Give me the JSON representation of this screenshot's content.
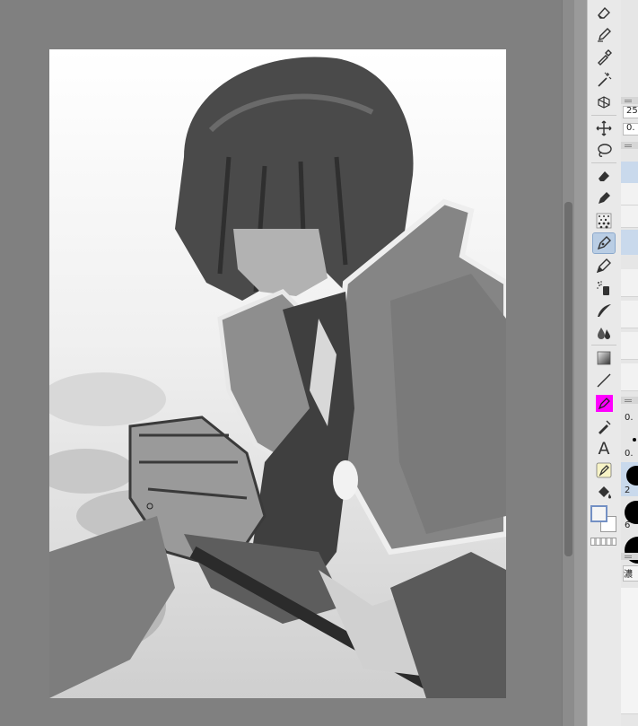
{
  "canvas": {
    "artwork": "grayscale painting"
  },
  "toolbar": {
    "tools": [
      {
        "name": "eraser-icon"
      },
      {
        "name": "pen-check-icon"
      },
      {
        "name": "eyedropper-icon"
      },
      {
        "name": "magic-wand-icon"
      },
      {
        "name": "object-select-icon"
      },
      {
        "name": "move-icon"
      },
      {
        "name": "lasso-icon"
      },
      {
        "name": "eraser-icon"
      },
      {
        "name": "pen-nib-icon"
      },
      {
        "name": "tone-dots-icon"
      },
      {
        "name": "pen-active-icon"
      },
      {
        "name": "marker-icon"
      },
      {
        "name": "spray-icon"
      },
      {
        "name": "brush-stroke-icon"
      },
      {
        "name": "blend-drops-icon"
      },
      {
        "name": "gradient-icon"
      },
      {
        "name": "line-icon"
      },
      {
        "name": "magenta-color-icon"
      },
      {
        "name": "ruler-pen-icon"
      },
      {
        "name": "text-icon"
      },
      {
        "name": "correction-pen-icon"
      },
      {
        "name": "fill-bucket-icon"
      }
    ],
    "main_color": "#f5f5f5",
    "accent_magenta": "#ff00ff"
  },
  "right_panel": {
    "brush_size_partial": "25",
    "opacity_partial": "0.",
    "size_label_1": "0.",
    "size_label_2": "0.",
    "size_label_3": "2",
    "size_label_4": "6",
    "density_label_partial": "濃"
  }
}
